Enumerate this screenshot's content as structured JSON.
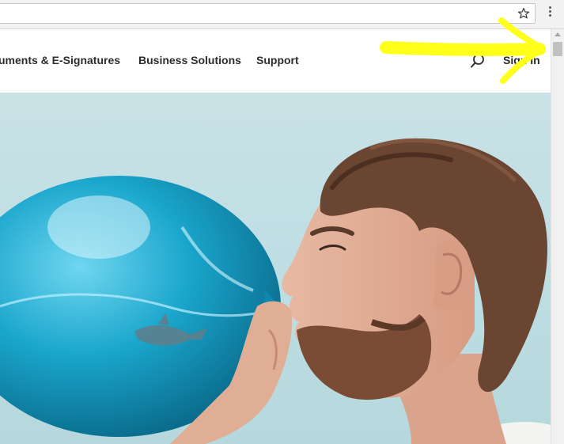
{
  "browser": {
    "menu_icon": "three-dot-vertical-icon",
    "bookmark_icon": "star-icon"
  },
  "nav": {
    "items": [
      {
        "label": "uments & E-Signatures"
      },
      {
        "label": "Business Solutions"
      },
      {
        "label": "Support"
      }
    ],
    "search_icon": "search-icon",
    "sign_in_label": "Sign In"
  },
  "hero": {
    "image": "man-blowing-blue-balloon-with-shark-photo"
  },
  "annotation": {
    "type": "yellow-arrow-pointing-to-sign-in",
    "color": "#ffff1a"
  },
  "colors": {
    "nav_text": "#2c2c2c",
    "hero_background": "#c5e1e5",
    "balloon": "#1aa3c8"
  }
}
